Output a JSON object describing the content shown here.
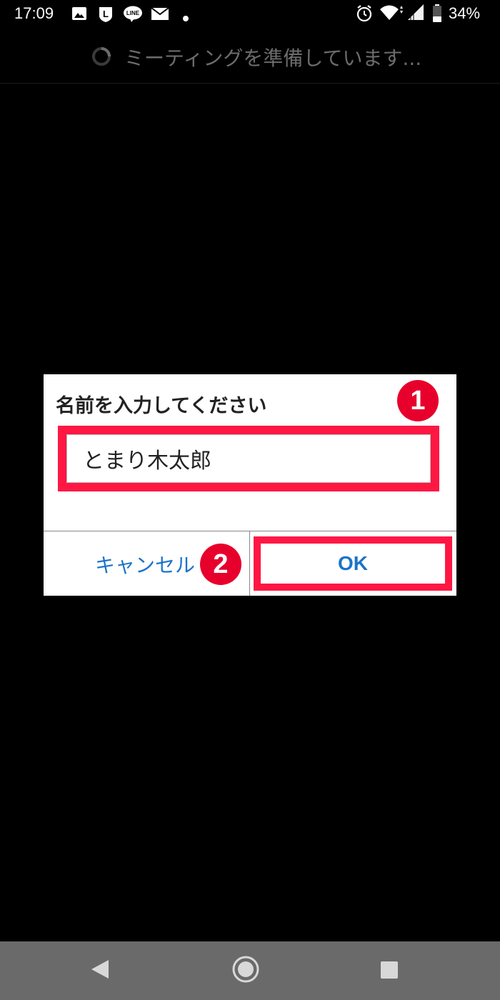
{
  "status_bar": {
    "time": "17:09",
    "battery": "34%",
    "notification_icons": [
      "image-icon",
      "l-app-icon",
      "line-app-icon",
      "mail-icon",
      "dot-icon"
    ],
    "line_icon_text": "LINE",
    "l_icon_text": "L",
    "system_icons": [
      "alarm-icon",
      "wifi-icon",
      "signal-icon",
      "battery-icon"
    ]
  },
  "header": {
    "status_text": "ミーティングを準備しています..."
  },
  "dialog": {
    "title": "名前を入力してください",
    "name_input_value": "とまり木太郎",
    "cancel_label": "キャンセル",
    "ok_label": "OK",
    "step_badges": [
      "1",
      "2"
    ]
  },
  "nav_bar": {
    "buttons": [
      "back-icon",
      "home-icon",
      "recents-icon"
    ]
  },
  "colors": {
    "background": "#000000",
    "highlight": "#ff1744",
    "badge": "#e8002c",
    "button_text": "#1a73c9",
    "nav_bar": "#6a6a6a"
  }
}
